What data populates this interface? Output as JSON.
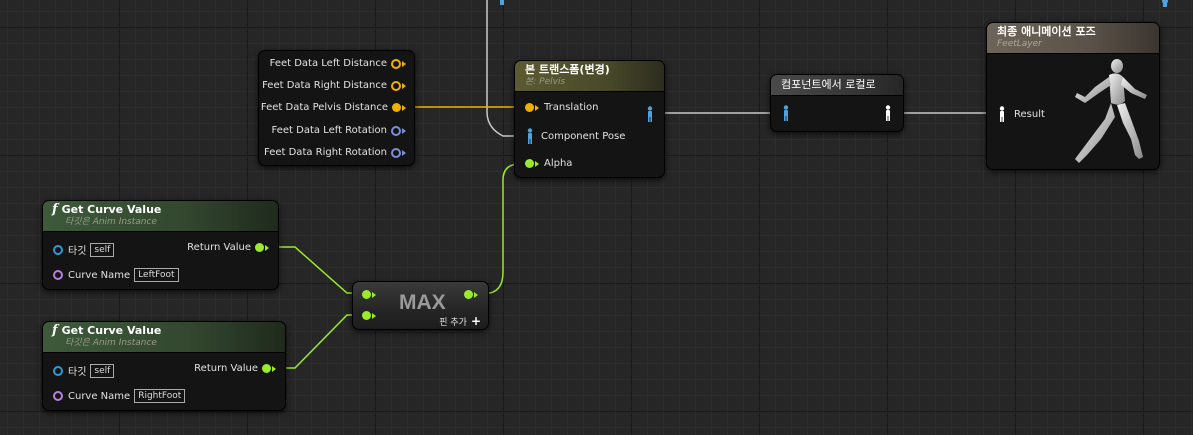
{
  "feet_data_node": {
    "pins": [
      {
        "label": "Feet Data Left Distance",
        "type": "struct"
      },
      {
        "label": "Feet Data Right Distance",
        "type": "struct"
      },
      {
        "label": "Feet Data Pelvis Distance",
        "type": "struct-connected"
      },
      {
        "label": "Feet Data Left Rotation",
        "type": "rotator"
      },
      {
        "label": "Feet Data Right Rotation",
        "type": "rotator"
      }
    ]
  },
  "bone_transform_node": {
    "title": "본 트랜스폼(변경)",
    "subtitle": "본: Pelvis",
    "pins": [
      {
        "label": "Translation"
      },
      {
        "label": "Component Pose"
      },
      {
        "label": "Alpha"
      }
    ]
  },
  "component_to_local_node": {
    "title": "컴포넌트에서 로컬로"
  },
  "final_pose_node": {
    "title": "최종 애니메이션 포즈",
    "subtitle": "FeetLayer",
    "result_label": "Result"
  },
  "curve_nodes": [
    {
      "title": "Get Curve Value",
      "subtitle": "타깃은 Anim Instance",
      "target_label": "타깃",
      "target_value": "self",
      "curve_label": "Curve Name",
      "curve_value": "LeftFoot",
      "return_label": "Return Value"
    },
    {
      "title": "Get Curve Value",
      "subtitle": "타깃은 Anim Instance",
      "target_label": "타깃",
      "target_value": "self",
      "curve_label": "Curve Name",
      "curve_value": "RightFoot",
      "return_label": "Return Value"
    }
  ],
  "max_node": {
    "title": "MAX",
    "add_pin_label": "핀 추가"
  },
  "colors": {
    "float_wire": "#9bea2b",
    "struct_wire": "#f1b000",
    "pose_wire": "#c8c8c8",
    "header_green": "#3d5a3a",
    "header_olive": "#5b5a33",
    "header_tan": "#6d6459",
    "header_gray": "#3e3e3e"
  },
  "icons": {
    "function": "f",
    "add": "+",
    "pose": "mannequin-icon"
  }
}
